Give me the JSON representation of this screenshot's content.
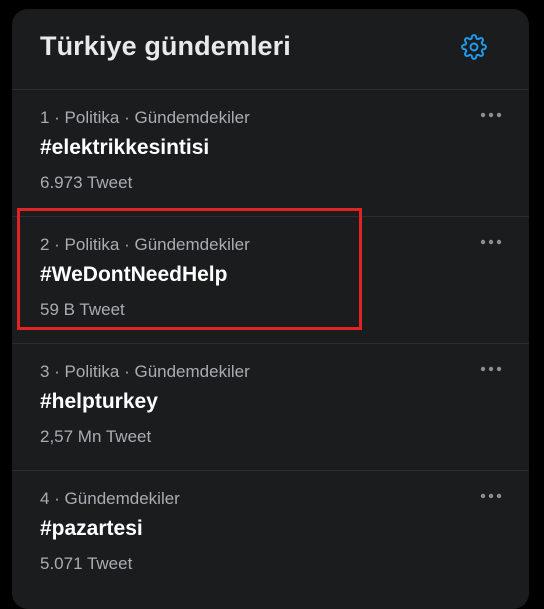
{
  "header": {
    "title": "Türkiye gündemleri",
    "settings_icon": "gear-icon"
  },
  "trends": [
    {
      "meta": "1 · Politika · Gündemdekiler",
      "tag": "#elektrikkesintisi",
      "count": "6.973 Tweet"
    },
    {
      "meta": "2 · Politika · Gündemdekiler",
      "tag": "#WeDontNeedHelp",
      "count": "59 B Tweet"
    },
    {
      "meta": "3 · Politika · Gündemdekiler",
      "tag": "#helpturkey",
      "count": "2,57 Mn Tweet"
    },
    {
      "meta": "4 · Gündemdekiler",
      "tag": "#pazartesi",
      "count": "5.071 Tweet"
    }
  ],
  "more_icon": "more-horizontal-icon",
  "colors": {
    "background": "#000000",
    "panel": "#1b1c1d",
    "accent": "#1d9bf0",
    "highlight": "#e02424",
    "secondary_text": "#a9adb2"
  }
}
